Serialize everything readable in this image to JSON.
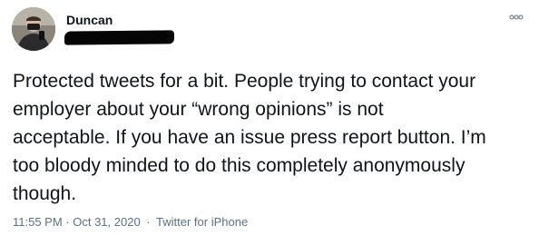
{
  "tweet": {
    "author": {
      "display_name": "Duncan",
      "avatar_icon": "profile-photo"
    },
    "more_icon": "more-dots-icon",
    "text_lines": [
      "Protected tweets for a bit. People trying to contact your",
      "employer about your “wrong opinions” is not",
      "acceptable. If you have an issue press report button. I’m",
      "too bloody minded to do this completely anonymously",
      "though."
    ],
    "timestamp": "11:55 PM · Oct 31, 2020",
    "separator": "·",
    "source": "Twitter for iPhone"
  },
  "colors": {
    "text": "#0f1419",
    "secondary": "#5b7083",
    "redaction": "#050505"
  }
}
